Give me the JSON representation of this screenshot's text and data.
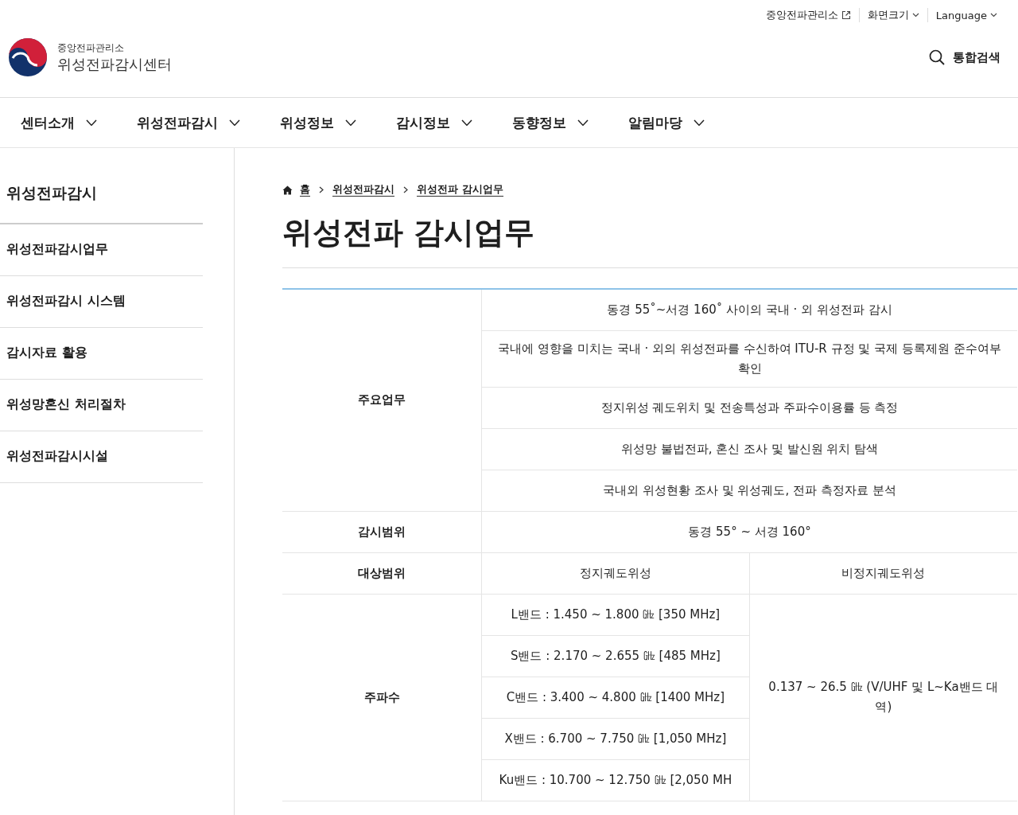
{
  "utility_links": [
    {
      "label": "중앙전파관리소",
      "kind": "external"
    },
    {
      "label": "화면크기",
      "kind": "menu"
    },
    {
      "label": "Language",
      "kind": "menu"
    }
  ],
  "logo": {
    "org": "중앙전파관리소",
    "name": "위성전파감시센터"
  },
  "search_button": {
    "label": "통합검색"
  },
  "nav": [
    "센터소개",
    "위성전파감시",
    "위성정보",
    "감시정보",
    "동향정보",
    "알림마당"
  ],
  "sidebar": {
    "title": "위성전파감시",
    "items": [
      "위성전파감시업무",
      "위성전파감시 시스템",
      "감시자료 활용",
      "위성망혼신 처리절차",
      "위성전파감시시설"
    ]
  },
  "breadcrumb": [
    "홈",
    "위성전파감시",
    "위성전파 감시업무"
  ],
  "page_title": "위성전파 감시업무",
  "table": {
    "sections": [
      {
        "header": "주요업무",
        "columns": [
          {
            "cells": [
              "동경 55˚~서경 160˚ 사이의 국내 · 외 위성전파 감시",
              "국내에 영향을 미치는 국내 · 외의 위성전파를 수신하여 ITU-R 규정 및 국제 등록제원 준수여부 확인",
              "정지위성 궤도위치 및 전송특성과 주파수이용률 등 측정",
              "위성망 불법전파, 혼신 조사 및 발신원 위치 탐색",
              "국내외 위성현황 조사 및 위성궤도, 전파 측정자료 분석"
            ]
          }
        ]
      },
      {
        "header": "감시범위",
        "columns": [
          {
            "cells": [
              "동경 55° ~ 서경 160°"
            ]
          }
        ]
      },
      {
        "header": "대상범위",
        "columns": [
          {
            "cells": [
              "정지궤도위성"
            ]
          },
          {
            "cells": [
              "비정지궤도위성"
            ]
          }
        ]
      },
      {
        "header": "주파수",
        "columns": [
          {
            "cells": [
              "L밴드 : 1.450 ~ 1.800 ㎓ [350 MHz]",
              "S밴드 : 2.170 ~ 2.655 ㎓ [485 MHz]",
              "C밴드 : 3.400 ~ 4.800 ㎓ [1400 MHz]",
              "X밴드 : 6.700 ~ 7.750 ㎓ [1,050 MHz]",
              "Ku밴드 : 10.700 ~ 12.750 ㎓ [2,050 MH"
            ]
          },
          {
            "cells": [
              "0.137 ~ 26.5 ㎓ (V/UHF 및 L~Ka밴드 대역)"
            ]
          }
        ]
      }
    ]
  }
}
